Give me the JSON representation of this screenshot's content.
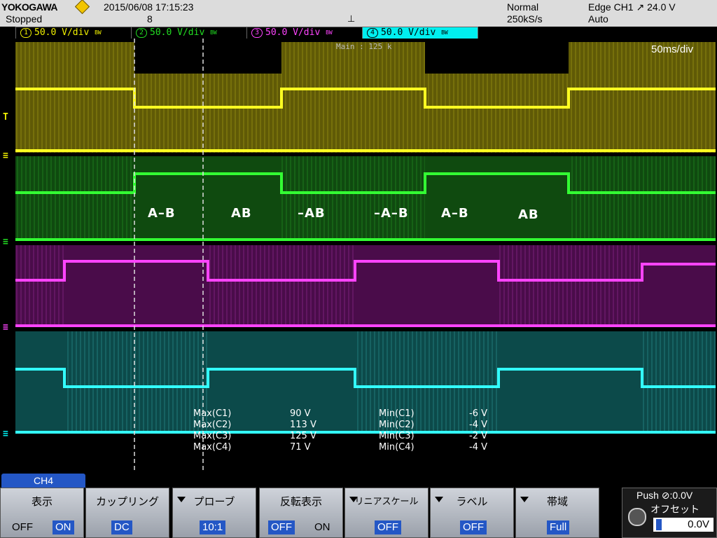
{
  "status": {
    "brand": "YOKOGAWA",
    "run_state": "Stopped",
    "datetime": "2015/06/08  17:15:23",
    "acq_count": "8",
    "trigger_pos_marker": "⊥",
    "acq_mode": "Normal",
    "sample_rate": "250kS/s",
    "trigger": "Edge CH1 ↗ 24.0 V",
    "trigger_mode": "Auto"
  },
  "channels": [
    {
      "num": "1",
      "scale": "50.0 V/div",
      "color": "#f0f000"
    },
    {
      "num": "2",
      "scale": "50.0 V/div",
      "color": "#22dd22"
    },
    {
      "num": "3",
      "scale": "50.0 V/div",
      "color": "#ff44ff"
    },
    {
      "num": "4",
      "scale": "50.0 V/div",
      "color": "#00f0f0"
    }
  ],
  "bw_limit_mark": "BW",
  "display": {
    "timebase": "50ms/div",
    "main_label": "Main : 125 k",
    "level_marker": "T",
    "ground_marker": "≡",
    "annotations": [
      "A–B",
      "AB",
      "–AB",
      "–A–B",
      "A–B",
      "AB"
    ]
  },
  "measurements": {
    "max": [
      {
        "label": "Max(C1)",
        "value": "90 V"
      },
      {
        "label": "Max(C2)",
        "value": "113 V"
      },
      {
        "label": "Max(C3)",
        "value": "125 V"
      },
      {
        "label": "Max(C4)",
        "value": "71 V"
      }
    ],
    "min": [
      {
        "label": "Min(C1)",
        "value": "-6 V"
      },
      {
        "label": "Min(C2)",
        "value": "-4 V"
      },
      {
        "label": "Min(C3)",
        "value": "-2 V"
      },
      {
        "label": "Min(C4)",
        "value": "-4 V"
      }
    ]
  },
  "menu": {
    "channel_tab": "CH4",
    "display": {
      "title": "表示",
      "off": "OFF",
      "on": "ON"
    },
    "coupling": {
      "title": "カップリング",
      "value": "DC"
    },
    "probe": {
      "title": "プローブ",
      "value": "10:1"
    },
    "invert": {
      "title": "反転表示",
      "off": "OFF",
      "on": "ON"
    },
    "linear_scale": {
      "title": "リニアスケール",
      "value": "OFF"
    },
    "label": {
      "title": "ラベル",
      "value": "OFF"
    },
    "bandwidth": {
      "title": "帯域",
      "value": "Full"
    },
    "offset": {
      "push_label": "Push ⊘:0.0V",
      "title": "オフセット",
      "value": "0.0V"
    }
  }
}
